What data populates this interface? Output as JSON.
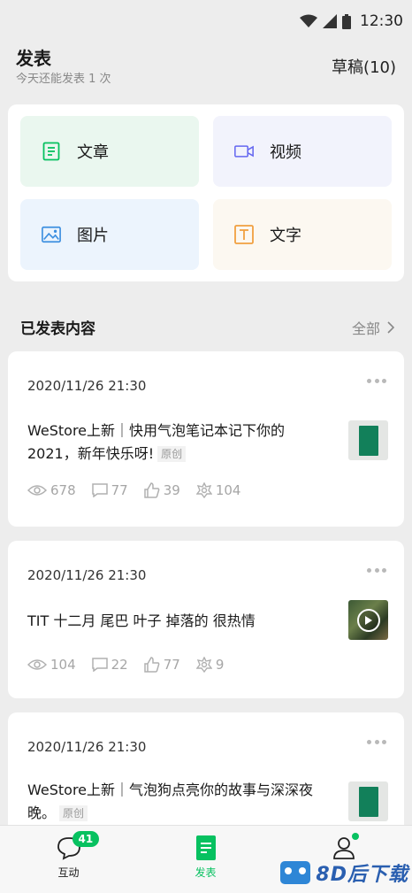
{
  "status": {
    "time": "12:30"
  },
  "header": {
    "title": "发表",
    "subtitle": "今天还能发表 1 次",
    "drafts": "草稿(10)"
  },
  "create": [
    {
      "label": "文章",
      "icon": "article-icon",
      "color": "#07c160"
    },
    {
      "label": "视频",
      "icon": "video-icon",
      "color": "#6467f0"
    },
    {
      "label": "图片",
      "icon": "image-icon",
      "color": "#3d8fe0"
    },
    {
      "label": "文字",
      "icon": "text-icon",
      "color": "#f0a040"
    }
  ],
  "section": {
    "title": "已发表内容",
    "all": "全部"
  },
  "posts": [
    {
      "date": "2020/11/26 21:30",
      "text": "WeStore上新｜快用气泡笔记本记下你的2021，新年快乐呀!",
      "tag": "原创",
      "views": "678",
      "comments": "77",
      "likes": "39",
      "shares": "104"
    },
    {
      "date": "2020/11/26 21:30",
      "text": "TIT 十二月 尾巴 叶子 掉落的 很热情",
      "views": "104",
      "comments": "22",
      "likes": "77",
      "shares": "9"
    },
    {
      "date": "2020/11/26 21:30",
      "text": "WeStore上新｜气泡狗点亮你的故事与深深夜晚。",
      "tag": "原创"
    }
  ],
  "nav": {
    "interact": "互动",
    "interact_badge": "41",
    "publish": "发表"
  },
  "watermark": "8D后下载",
  "colors": {
    "accent": "#07c160"
  }
}
